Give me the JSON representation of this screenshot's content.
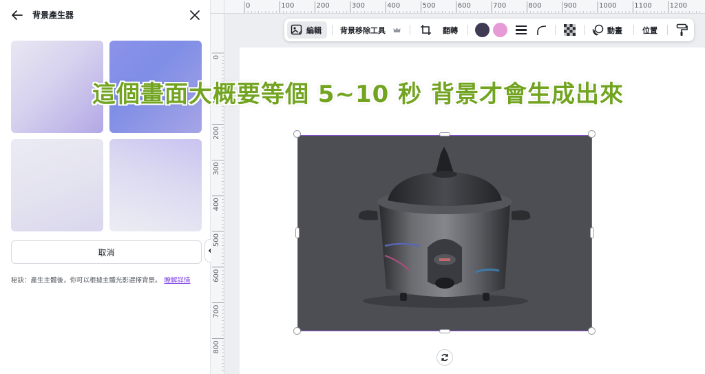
{
  "panel": {
    "title": "背景產生器",
    "cancel_label": "取消",
    "tip_text": "秘訣：產生主體後，你可以根據主體光影選擇背景。",
    "tip_link": "瞭解詳情"
  },
  "toolbar": {
    "edit_label": "編輯",
    "bg_remove_label": "背景移除工具",
    "flip_label": "翻轉",
    "animate_label": "動畫",
    "position_label": "位置",
    "swatch_1": "#3f3b55",
    "swatch_2": "#e79bd6"
  },
  "ruler": {
    "top_labels": [
      "0",
      "100",
      "200",
      "300",
      "400",
      "500",
      "600",
      "700",
      "800",
      "900",
      "1000",
      "1100",
      "1200"
    ],
    "left_labels": [
      "0",
      "100",
      "200",
      "300",
      "400",
      "500",
      "600",
      "700",
      "800"
    ]
  },
  "caption": "這個畫面大概要等個 5~10 秒  背景才會生成出來",
  "icons": {
    "back": "arrow-left",
    "close": "x",
    "crown": "crown",
    "crop": "crop",
    "line_style": "lines",
    "corner": "corner-radius",
    "transparency": "checker",
    "animate": "animate-circle",
    "paint": "paint-roller",
    "collapse": "chevron-left",
    "rotate": "rotate-arrows"
  }
}
